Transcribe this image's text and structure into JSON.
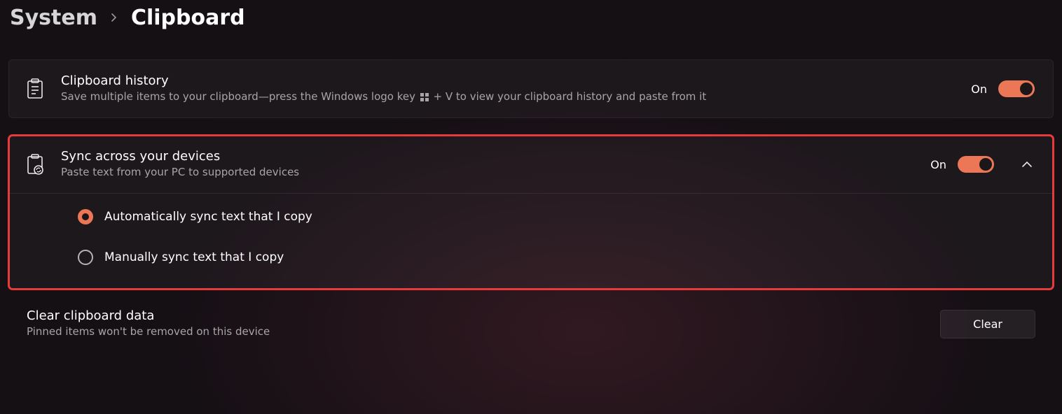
{
  "breadcrumb": {
    "parent": "System",
    "current": "Clipboard"
  },
  "history": {
    "title": "Clipboard history",
    "desc_before": "Save multiple items to your clipboard—press the Windows logo key ",
    "desc_after": " + V to view your clipboard history and paste from it",
    "state_label": "On"
  },
  "sync": {
    "title": "Sync across your devices",
    "desc": "Paste text from your PC to supported devices",
    "state_label": "On",
    "options": {
      "auto": "Automatically sync text that I copy",
      "manual": "Manually sync text that I copy"
    }
  },
  "clear": {
    "title": "Clear clipboard data",
    "desc": "Pinned items won't be removed on this device",
    "button": "Clear"
  }
}
